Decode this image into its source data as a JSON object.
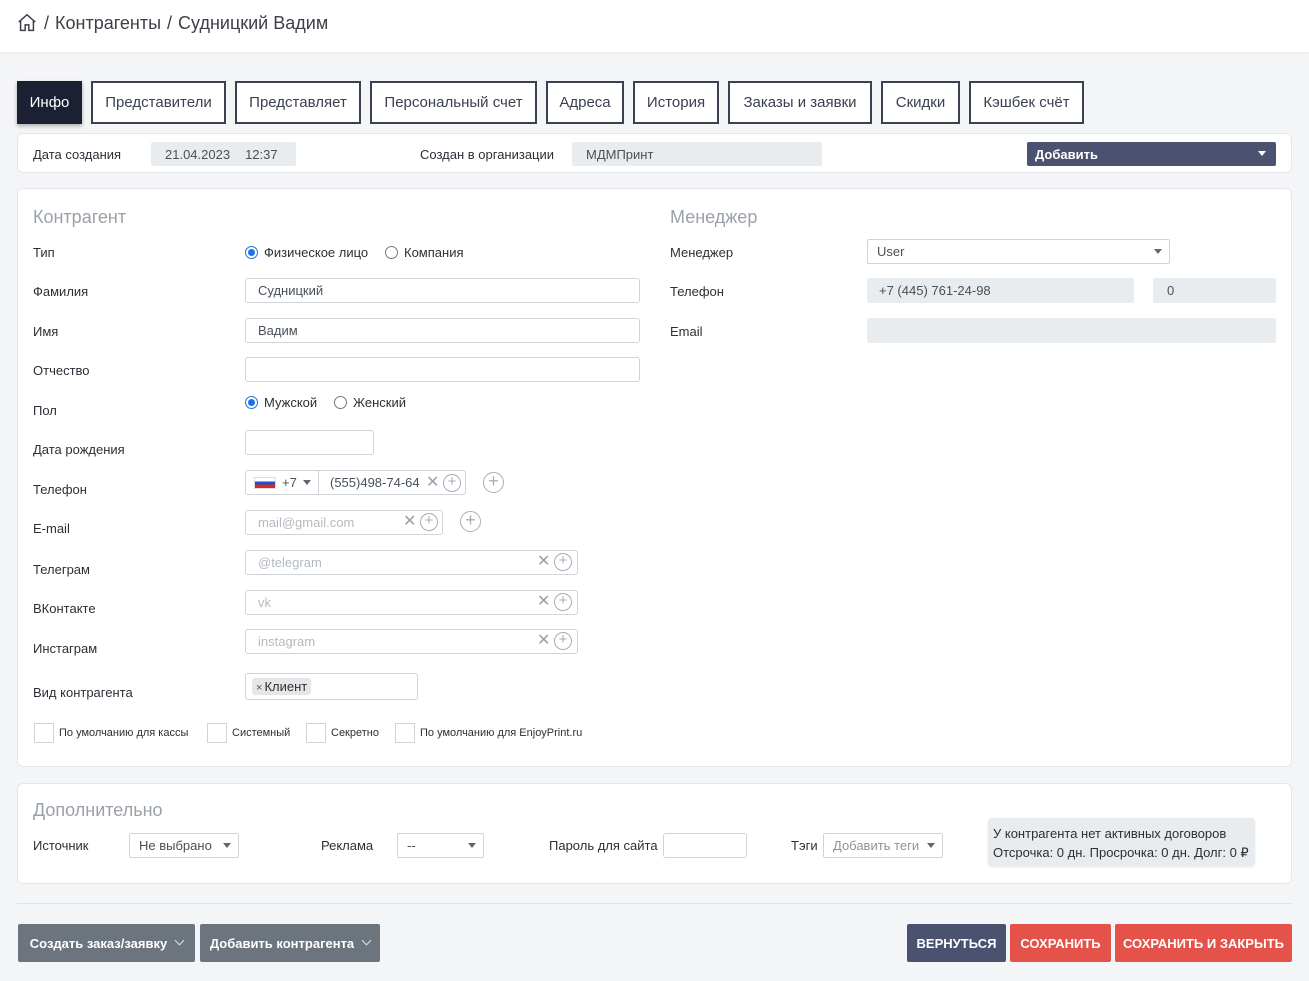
{
  "breadcrumb": {
    "home_icon": "home-icon",
    "sep": "/",
    "section": "Контрагенты",
    "current": "Судницкий Вадим"
  },
  "tabs": [
    "Инфо",
    "Представители",
    "Представляет",
    "Персональный счет",
    "Адреса",
    "История",
    "Заказы и заявки",
    "Скидки",
    "Кэшбек счёт"
  ],
  "infobar": {
    "created_label": "Дата создания",
    "created_date": "21.04.2023",
    "created_time": "12:37",
    "org_label": "Создан в организации",
    "org_value": "МДМПринт",
    "add_select": "Добавить"
  },
  "contragent": {
    "title": "Контрагент",
    "type_label": "Тип",
    "type_options": [
      "Физическое лицо",
      "Компания"
    ],
    "type_selected": "Физическое лицо",
    "lastname_label": "Фамилия",
    "lastname": "Судницкий",
    "firstname_label": "Имя",
    "firstname": "Вадим",
    "middlename_label": "Отчество",
    "middlename": "",
    "gender_label": "Пол",
    "gender_options": [
      "Мужской",
      "Женский"
    ],
    "gender_selected": "Мужской",
    "birth_label": "Дата рождения",
    "birth": "",
    "phone_label": "Телефон",
    "phone_code": "+7",
    "phone": "(555)498-74-64",
    "email_label": "E-mail",
    "email_placeholder": "mail@gmail.com",
    "telegram_label": "Телеграм",
    "telegram_placeholder": "@telegram",
    "vk_label": "ВКонтакте",
    "vk_placeholder": "vk",
    "instagram_label": "Инстаграм",
    "instagram_placeholder": "instagram",
    "kind_label": "Вид контрагента",
    "kind_chip": "Клиент",
    "checkboxes": [
      "По умолчанию для кассы",
      "Системный",
      "Секретно",
      "По умолчанию для EnjoyPrint.ru"
    ]
  },
  "manager": {
    "title": "Менеджер",
    "manager_label": "Менеджер",
    "manager_value": "User",
    "phone_label": "Телефон",
    "phone": "+7 (445) 761-24-98",
    "ext": "0",
    "email_label": "Email",
    "email": ""
  },
  "extra": {
    "title": "Дополнительно",
    "source_label": "Источник",
    "source_value": "Не выбрано",
    "ad_label": "Реклама",
    "ad_value": "--",
    "password_label": "Пароль для сайта",
    "tags_label": "Тэги",
    "tags_placeholder": "Добавить теги",
    "contract_line1": "У контрагента нет активных договоров",
    "contract_line2": "Отсрочка: 0 дн. Просрочка: 0 дн. Долг: 0 ₽"
  },
  "footer": {
    "create_order": "Создать заказ/заявку",
    "add_contragent": "Добавить контрагента",
    "back": "ВЕРНУТЬСЯ",
    "save": "СОХРАНИТЬ",
    "save_close": "СОХРАНИТЬ И ЗАКРЫТЬ"
  },
  "colors": {
    "navy": "#1c2033",
    "slate": "#4a5270",
    "red": "#e5524a",
    "grey": "#6c757d",
    "radio": "#1a73e8"
  }
}
